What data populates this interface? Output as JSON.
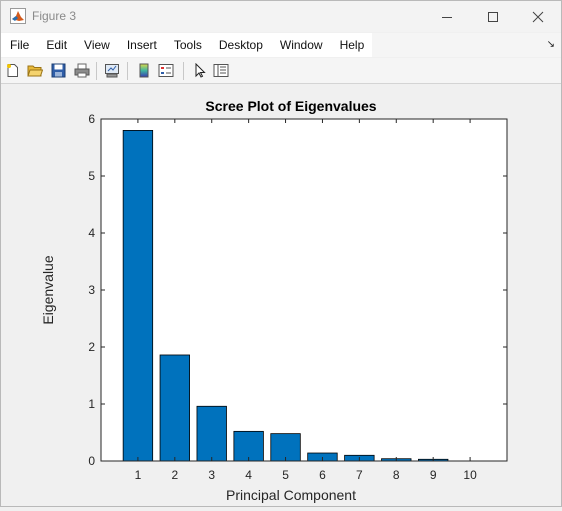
{
  "window": {
    "title": "Figure 3"
  },
  "menu": {
    "items": [
      "File",
      "Edit",
      "View",
      "Insert",
      "Tools",
      "Desktop",
      "Window",
      "Help"
    ]
  },
  "toolbar": {
    "buttons": [
      "new-figure-icon",
      "open-file-icon",
      "save-icon",
      "print-icon",
      "link-plot-icon",
      "colorbar-icon",
      "legend-icon",
      "edit-plot-icon",
      "property-inspector-icon"
    ]
  },
  "colors": {
    "bar": "#0072bd",
    "axes_background": "#ffffff"
  },
  "chart_data": {
    "type": "bar",
    "title": "Scree Plot of Eigenvalues",
    "xlabel": "Principal Component",
    "ylabel": "Eigenvalue",
    "categories": [
      "1",
      "2",
      "3",
      "4",
      "5",
      "6",
      "7",
      "8",
      "9",
      "10"
    ],
    "values": [
      5.8,
      1.86,
      0.96,
      0.52,
      0.48,
      0.14,
      0.1,
      0.04,
      0.03,
      0.0
    ],
    "ylim": [
      0,
      6
    ],
    "yticks": [
      "0",
      "1",
      "2",
      "3",
      "4",
      "5",
      "6"
    ],
    "grid": false
  }
}
